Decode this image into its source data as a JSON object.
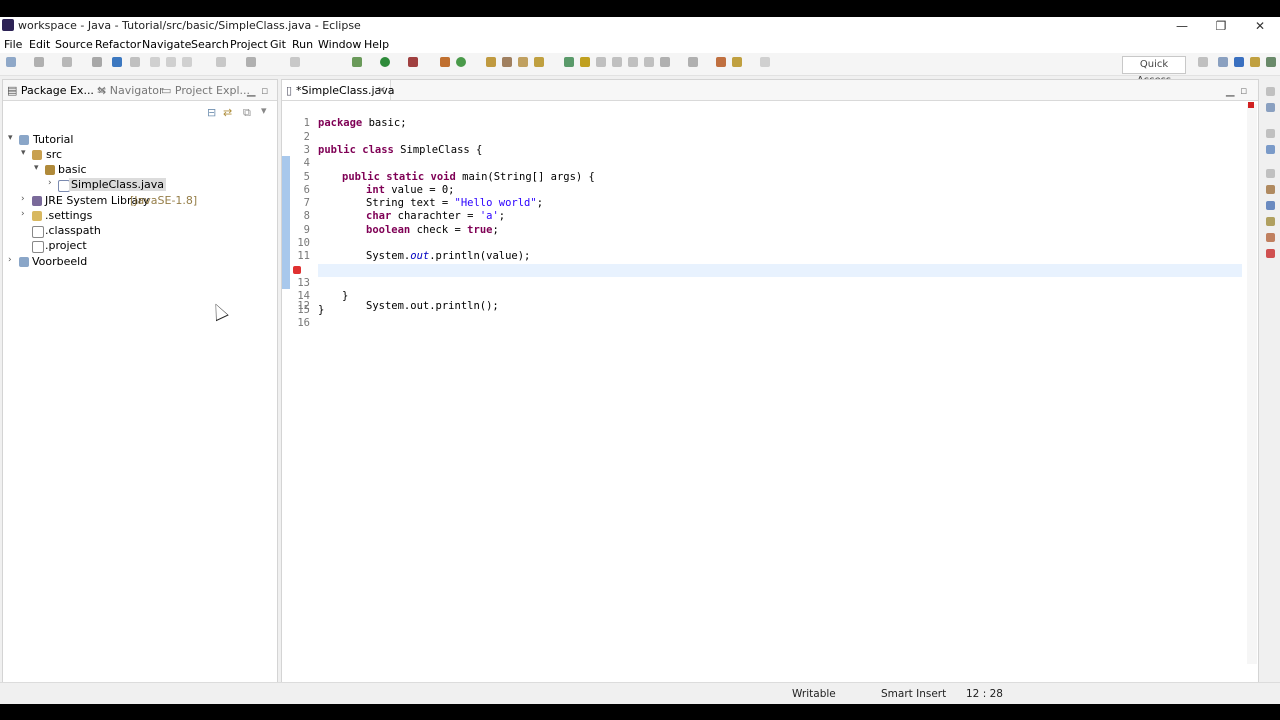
{
  "window": {
    "title": "workspace - Java - Tutorial/src/basic/SimpleClass.java - Eclipse",
    "minimize": "—",
    "maximize": "❐",
    "close": "✕"
  },
  "menu": [
    "File",
    "Edit",
    "Source",
    "Refactor",
    "Navigate",
    "Search",
    "Project",
    "Git",
    "Run",
    "Window",
    "Help"
  ],
  "toolbar": {
    "quick_access": "Quick Access"
  },
  "left_panel": {
    "tabs": [
      "Package Ex...",
      "Navigator",
      "Project Expl..."
    ],
    "tree": [
      {
        "label": "Tutorial",
        "twisty": "▾"
      },
      {
        "label": "src",
        "twisty": "▾"
      },
      {
        "label": "basic",
        "twisty": "▾"
      },
      {
        "label": "SimpleClass.java",
        "twisty": "›"
      },
      {
        "label": "JRE System Library",
        "extra": "[JavaSE-1.8]",
        "twisty": "›"
      },
      {
        "label": ".settings",
        "twisty": "›"
      },
      {
        "label": ".classpath",
        "twisty": ""
      },
      {
        "label": ".project",
        "twisty": ""
      },
      {
        "label": "Voorbeeld",
        "twisty": "›"
      }
    ]
  },
  "editor": {
    "tab_label": "*SimpleClass.java",
    "tab_close": "✕",
    "lines": [
      {
        "n": "1",
        "text": ""
      },
      {
        "n": "2",
        "text": ""
      },
      {
        "n": "3",
        "text": ""
      },
      {
        "n": "4",
        "text": ""
      },
      {
        "n": "5",
        "text": ""
      },
      {
        "n": "6",
        "text": ""
      },
      {
        "n": "7",
        "text": ""
      },
      {
        "n": "8",
        "text": ""
      },
      {
        "n": "9",
        "text": ""
      },
      {
        "n": "10",
        "text": ""
      },
      {
        "n": "11",
        "text": ""
      },
      {
        "n": "12",
        "text": ""
      },
      {
        "n": "13",
        "text": ""
      },
      {
        "n": "14",
        "text": ""
      },
      {
        "n": "15",
        "text": ""
      },
      {
        "n": "16",
        "text": ""
      }
    ],
    "code": {
      "l1_kw": "package",
      "l1_rest": " basic;",
      "l3_kw": "public class",
      "l3_rest": " SimpleClass {",
      "l5_kw": "public static void",
      "l5_rest": " main(String[] args) {",
      "l6_kw": "int",
      "l6_rest": " value = 0;",
      "l7_rest1": "String text = ",
      "l7_str": "\"Hello world\"",
      "l7_rest2": ";",
      "l8_kw": "char",
      "l8_rest1": " charachter = ",
      "l8_str": "'a'",
      "l8_rest2": ";",
      "l9_kw": "boolean",
      "l9_rest1": " check = ",
      "l9_kw2": "true",
      "l9_rest2": ";",
      "l11_a": "System.",
      "l11_fld": "out",
      "l11_b": ".println(value);",
      "l12": "System.out.println();",
      "l14": "}",
      "l15": "}"
    }
  },
  "status": {
    "writable": "Writable",
    "insert_mode": "Smart Insert",
    "position": "12 : 28"
  },
  "colors": {
    "keyword": "#7f0055",
    "string": "#2a00ff",
    "field": "#0000c0",
    "current_line": "#e8f2fe"
  }
}
